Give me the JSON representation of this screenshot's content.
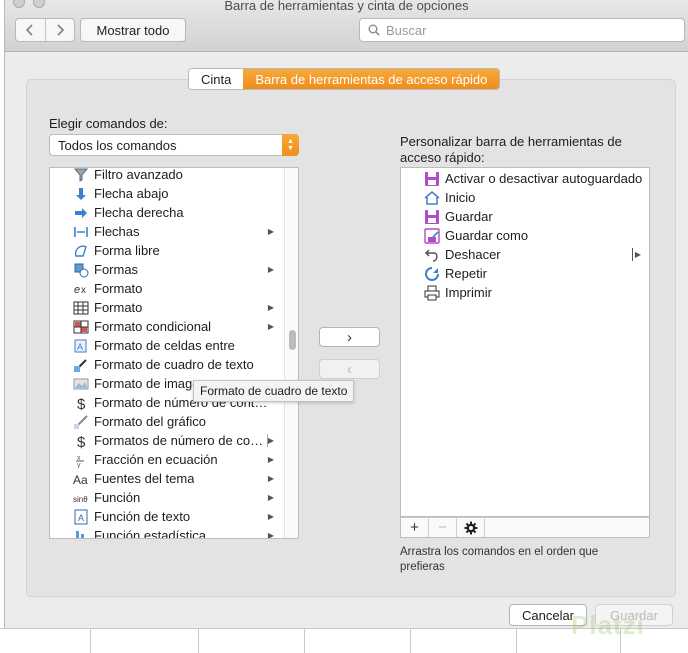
{
  "window": {
    "title": "Barra de herramientas y cinta de opciones"
  },
  "toolbar": {
    "back_icon": "chevron-left-icon",
    "forward_icon": "chevron-right-icon",
    "show_all_label": "Mostrar todo",
    "search_placeholder": "Buscar"
  },
  "tabs": [
    {
      "label": "Cinta",
      "active": false
    },
    {
      "label": "Barra de herramientas de acceso rápido",
      "active": true
    }
  ],
  "colors": {
    "accent": "#F09A28",
    "accent_dark": "#EF8D1C"
  },
  "commands": {
    "choose_label": "Elegir comandos de:",
    "dropdown_value": "Todos los comandos",
    "items": [
      {
        "label": "Filtro avanzado",
        "icon": "advanced-filter-icon",
        "submenu": false
      },
      {
        "label": "Flecha abajo",
        "icon": "arrow-down-icon",
        "submenu": false
      },
      {
        "label": "Flecha derecha",
        "icon": "arrow-right-icon",
        "submenu": false
      },
      {
        "label": "Flechas",
        "icon": "arrows-icon",
        "submenu": true
      },
      {
        "label": "Forma libre",
        "icon": "freeform-icon",
        "submenu": false
      },
      {
        "label": "Formas",
        "icon": "shapes-icon",
        "submenu": true
      },
      {
        "label": "Formato",
        "icon": "format-script-icon",
        "submenu": false
      },
      {
        "label": "Formato",
        "icon": "format-table-icon",
        "submenu": true
      },
      {
        "label": "Formato condicional",
        "icon": "conditional-format-icon",
        "submenu": true
      },
      {
        "label": "Formato de celdas entre",
        "icon": "format-cells-icon",
        "submenu": false
      },
      {
        "label": "Formato de cuadro de texto",
        "icon": "textbox-format-icon",
        "submenu": false
      },
      {
        "label": "Formato de imagen",
        "icon": "image-format-icon",
        "submenu": false
      },
      {
        "label": "Formato de número de contabili...",
        "icon": "dollar-icon",
        "submenu": false
      },
      {
        "label": "Formato del gráfico",
        "icon": "chart-format-icon",
        "submenu": false
      },
      {
        "label": "Formatos de número de cont...",
        "icon": "dollar-icon",
        "submenu": true,
        "separator": true
      },
      {
        "label": "Fracción en ecuación",
        "icon": "fraction-icon",
        "submenu": true
      },
      {
        "label": "Fuentes del tema",
        "icon": "theme-fonts-icon",
        "submenu": true
      },
      {
        "label": "Función",
        "icon": "function-icon",
        "submenu": true
      },
      {
        "label": "Función de texto",
        "icon": "text-function-icon",
        "submenu": true
      },
      {
        "label": "Función estadística",
        "icon": "statistical-function-icon",
        "submenu": true
      }
    ],
    "tooltip": "Formato de cuadro de texto"
  },
  "move_buttons": {
    "add": "›",
    "remove": "‹"
  },
  "quick_access": {
    "label": "Personalizar barra de herramientas de acceso rápido:",
    "items": [
      {
        "label": "Activar o desactivar autoguardado",
        "icon": "autosave-icon",
        "submenu": false
      },
      {
        "label": "Inicio",
        "icon": "home-icon",
        "submenu": false
      },
      {
        "label": "Guardar",
        "icon": "save-icon",
        "submenu": false
      },
      {
        "label": "Guardar como",
        "icon": "save-as-icon",
        "submenu": false
      },
      {
        "label": "Deshacer",
        "icon": "undo-icon",
        "submenu": true,
        "separator": true
      },
      {
        "label": "Repetir",
        "icon": "redo-icon",
        "submenu": false
      },
      {
        "label": "Imprimir",
        "icon": "print-icon",
        "submenu": false
      }
    ],
    "tools": {
      "add": "+",
      "remove": "−"
    },
    "hint": "Arrastra los comandos en el orden que prefieras"
  },
  "footer": {
    "cancel_label": "Cancelar",
    "save_label": "Guardar"
  },
  "watermark": "Platzi"
}
